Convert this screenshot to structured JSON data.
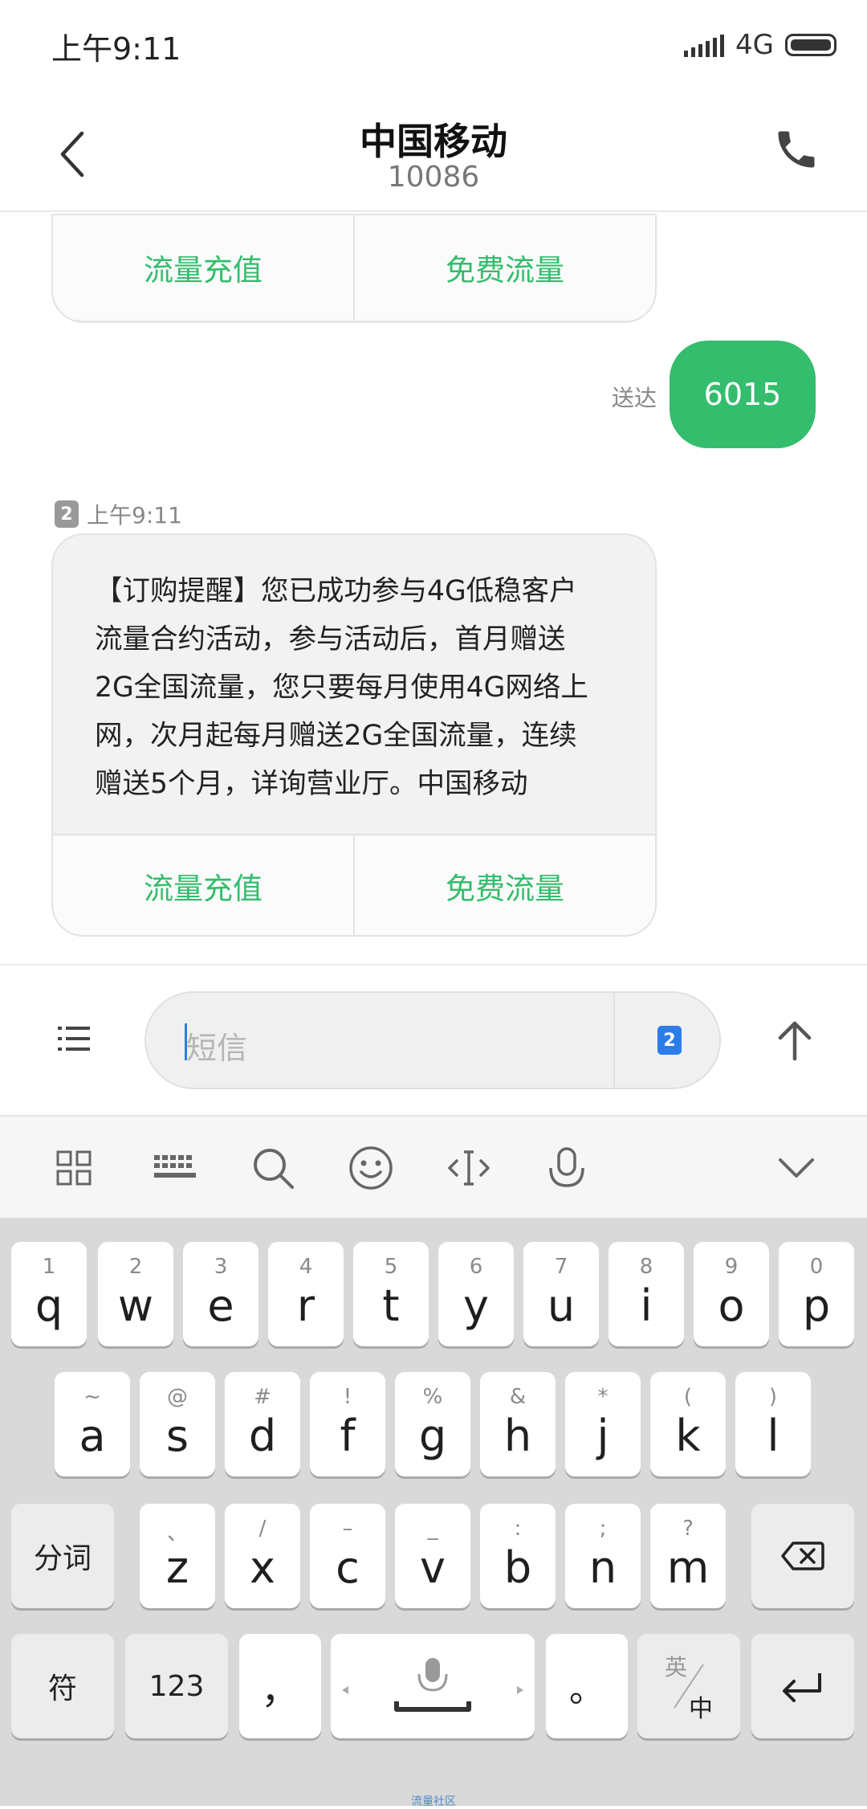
{
  "status_bar": {
    "time": "上午9:11",
    "network": "4G"
  },
  "header": {
    "title": "中国移动",
    "subtitle": "10086"
  },
  "cards": {
    "top": {
      "actions": [
        "流量充值",
        "免费流量"
      ]
    },
    "latest": {
      "sim": "2",
      "time": "上午9:11",
      "lines": [
        "【订购提醒】您已成功参与4G低稳客户",
        "流量合约活动，参与活动后，首月赠送",
        "2G全国流量，您只要每月使用4G网络上",
        "网，次月起每月赠送2G全国流量，连续",
        "赠送5个月，详询营业厅。中国移动"
      ],
      "actions": [
        "流量充值",
        "免费流量"
      ]
    }
  },
  "sent": {
    "text": "6015",
    "status": "送达"
  },
  "composer": {
    "placeholder": "短信",
    "sim": "2"
  },
  "keyboard": {
    "row1": [
      {
        "hint": "1",
        "key": "q"
      },
      {
        "hint": "2",
        "key": "w"
      },
      {
        "hint": "3",
        "key": "e"
      },
      {
        "hint": "4",
        "key": "r"
      },
      {
        "hint": "5",
        "key": "t"
      },
      {
        "hint": "6",
        "key": "y"
      },
      {
        "hint": "7",
        "key": "u"
      },
      {
        "hint": "8",
        "key": "i"
      },
      {
        "hint": "9",
        "key": "o"
      },
      {
        "hint": "0",
        "key": "p"
      }
    ],
    "row2": [
      {
        "hint": "~",
        "key": "a"
      },
      {
        "hint": "@",
        "key": "s"
      },
      {
        "hint": "#",
        "key": "d"
      },
      {
        "hint": "!",
        "key": "f"
      },
      {
        "hint": "%",
        "key": "g"
      },
      {
        "hint": "&",
        "key": "h"
      },
      {
        "hint": "*",
        "key": "j"
      },
      {
        "hint": "(",
        "key": "k"
      },
      {
        "hint": ")",
        "key": "l"
      }
    ],
    "row3": [
      {
        "hint": "、",
        "key": "z"
      },
      {
        "hint": "/",
        "key": "x"
      },
      {
        "hint": "–",
        "key": "c"
      },
      {
        "hint": "_",
        "key": "v"
      },
      {
        "hint": ":",
        "key": "b"
      },
      {
        "hint": ";",
        "key": "n"
      },
      {
        "hint": "?",
        "key": "m"
      }
    ],
    "segment_key": "分词",
    "symbol_key": "符",
    "number_key": "123",
    "comma_key": "，",
    "period_key": "。",
    "lang_top": "英",
    "lang_bottom": "中",
    "footer_brand": "流量社区"
  }
}
